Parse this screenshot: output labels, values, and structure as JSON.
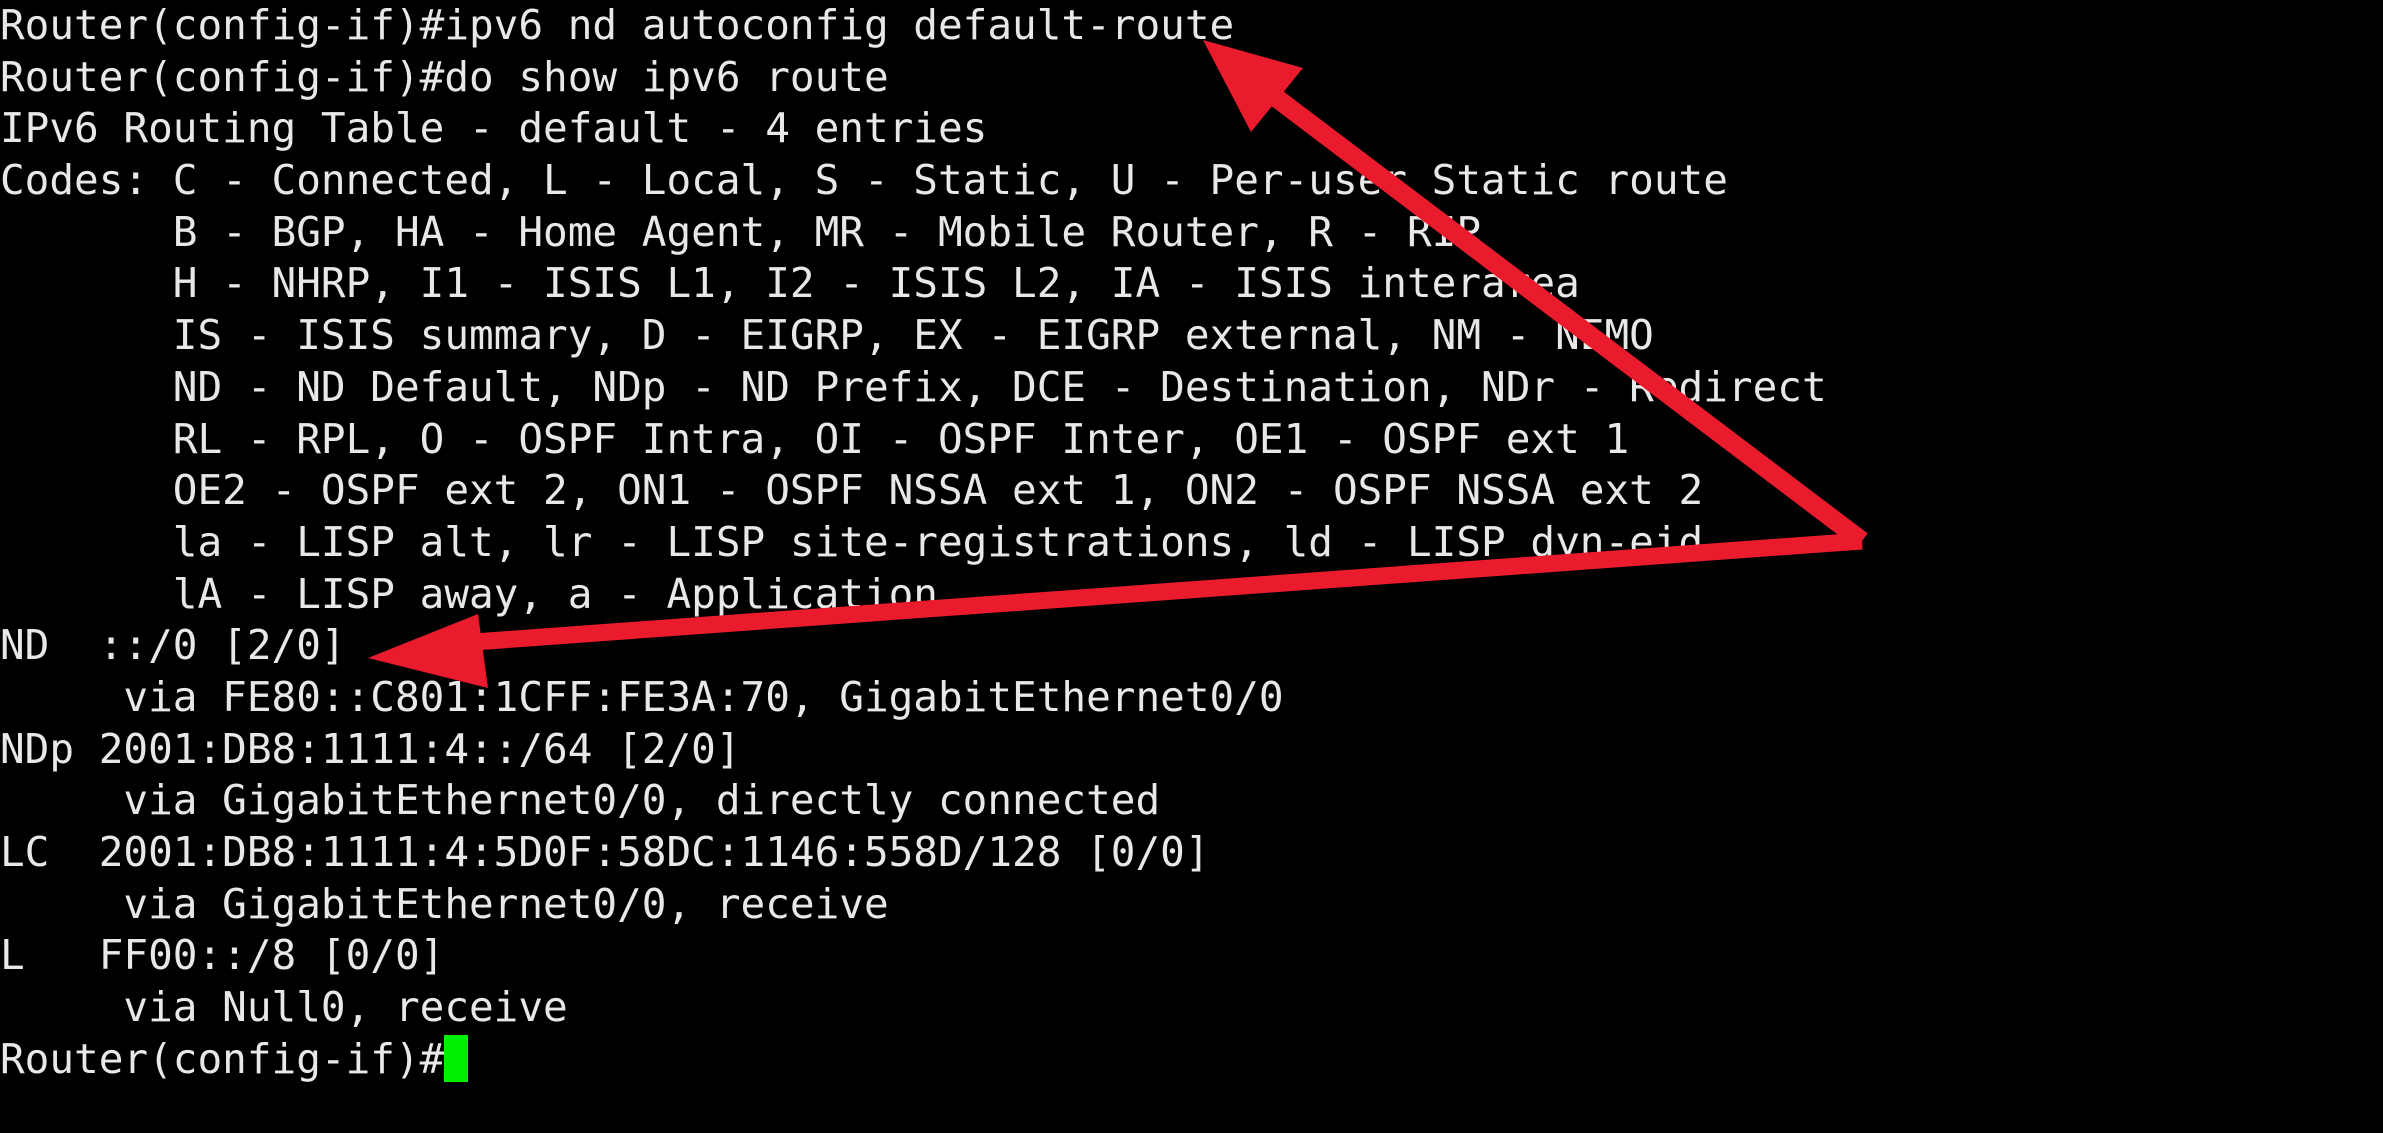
{
  "terminal": {
    "background_color": "#000000",
    "text_color": "#e8e8e8",
    "cursor_color": "#00ee00",
    "prompt": "Router(config-if)#",
    "lines": [
      "Router(config-if)#ipv6 nd autoconfig default-route",
      "Router(config-if)#do show ipv6 route",
      "IPv6 Routing Table - default - 4 entries",
      "Codes: C - Connected, L - Local, S - Static, U - Per-user Static route",
      "       B - BGP, HA - Home Agent, MR - Mobile Router, R - RIP",
      "       H - NHRP, I1 - ISIS L1, I2 - ISIS L2, IA - ISIS interarea",
      "       IS - ISIS summary, D - EIGRP, EX - EIGRP external, NM - NEMO",
      "       ND - ND Default, NDp - ND Prefix, DCE - Destination, NDr - Redirect",
      "       RL - RPL, O - OSPF Intra, OI - OSPF Inter, OE1 - OSPF ext 1",
      "       OE2 - OSPF ext 2, ON1 - OSPF NSSA ext 1, ON2 - OSPF NSSA ext 2",
      "       la - LISP alt, lr - LISP site-registrations, ld - LISP dyn-eid",
      "       lA - LISP away, a - Application",
      "ND  ::/0 [2/0]",
      "     via FE80::C801:1CFF:FE3A:70, GigabitEthernet0/0",
      "NDp 2001:DB8:1111:4::/64 [2/0]",
      "     via GigabitEthernet0/0, directly connected",
      "LC  2001:DB8:1111:4:5D0F:58DC:1146:558D/128 [0/0]",
      "     via GigabitEthernet0/0, receive",
      "L   FF00::/8 [0/0]",
      "     via Null0, receive"
    ],
    "final_prompt": "Router(config-if)#"
  },
  "annotations": {
    "arrow_color": "#ea1b2d",
    "items": [
      {
        "name": "arrow-to-command",
        "description": "red arrow pointing up-left to the 'ipv6 nd autoconfig default-route' command",
        "tip": "1203,40",
        "tail": "1860,540"
      },
      {
        "name": "arrow-to-nd-default-route",
        "description": "red arrow pointing left to the 'ND  ::/0 [2/0]' route entry",
        "tip": "368,658",
        "tail": "1860,540"
      }
    ]
  }
}
